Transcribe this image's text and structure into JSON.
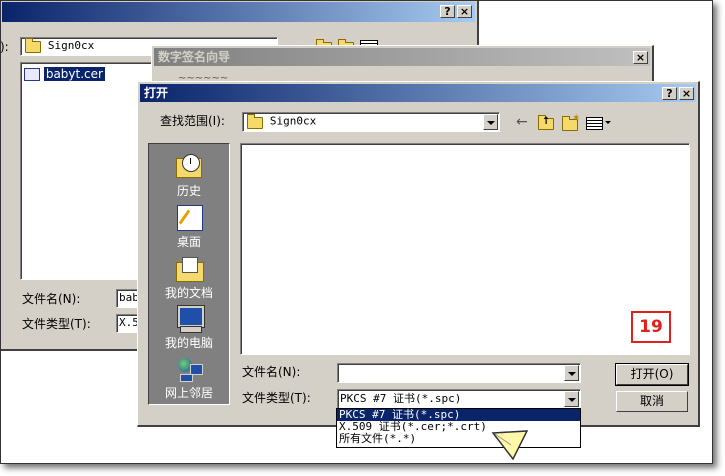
{
  "back_window": {
    "help_btn": "?",
    "close_btn": "×",
    "folder_value": "Sign0cx",
    "file_item": "babyt.cer",
    "filename_label": "文件名(N):",
    "filename_value": "bab",
    "filetype_label": "文件类型(T):",
    "filetype_value": "X.5"
  },
  "wizard": {
    "title": "数字签名向导",
    "close_btn": "×",
    "sub_text": "~~~~~~"
  },
  "open_dialog": {
    "title": "打开",
    "help_btn": "?",
    "close_btn": "×",
    "lookin_label": "查找范围(I):",
    "lookin_value": "Sign0cx",
    "places": [
      "历史",
      "桌面",
      "我的文档",
      "我的电脑",
      "网上邻居"
    ],
    "filename_label": "文件名(N):",
    "filename_value": "",
    "filetype_label": "文件类型(T):",
    "filetype_value": "PKCS #7 证书(*.spc)",
    "open_button": "打开(O)",
    "cancel_button": "取消",
    "filetype_options": [
      "PKCS #7 证书(*.spc)",
      "X.509 证书(*.cer;*.crt)",
      "所有文件(*.*)"
    ],
    "selected_option_index": 0
  },
  "step_badge": "19",
  "colors": {
    "titlebar_active": "#0a246a",
    "titlebar_inactive": "#808080",
    "dialog_face": "#d4d0c8",
    "badge_red": "#e0201c"
  }
}
